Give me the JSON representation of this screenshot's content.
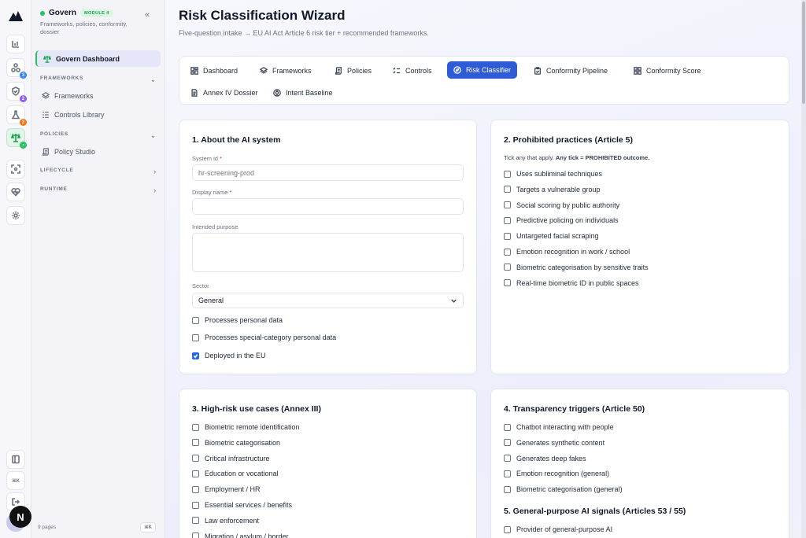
{
  "app": {
    "module_name": "Govern",
    "module_chip": "MODULE 4",
    "module_description": "Frameworks, policies, conformity, dossier"
  },
  "rail": {
    "badges": [
      "3",
      "2",
      "2"
    ],
    "badge_colors": [
      "#3b82f6",
      "#8b5cf6",
      "#f97316",
      "#22c55e"
    ],
    "kbd": "⌘K",
    "avatar_letter": "N"
  },
  "sidebar": {
    "dashboard": "Govern Dashboard",
    "sections": {
      "frameworks": "FRAMEWORKS",
      "policies": "POLICIES",
      "lifecycle": "LIFECYCLE",
      "runtime": "RUNTIME"
    },
    "frameworks_items": [
      "Frameworks",
      "Controls Library"
    ],
    "policies_items": [
      "Policy Studio"
    ],
    "footer_pages": "9 pages",
    "footer_kbd": "⌘K"
  },
  "header": {
    "title": "Risk Classification Wizard",
    "subtitle": "Five-question intake → EU AI Act Article 6 risk tier + recommended frameworks."
  },
  "tabs": [
    {
      "label": "Dashboard",
      "icon": "dashboard-icon"
    },
    {
      "label": "Frameworks",
      "icon": "layers-icon"
    },
    {
      "label": "Policies",
      "icon": "scroll-icon"
    },
    {
      "label": "Controls",
      "icon": "list-checks-icon"
    },
    {
      "label": "Risk Classifier",
      "icon": "compass-icon",
      "active": true
    },
    {
      "label": "Conformity Pipeline",
      "icon": "clipboard-icon"
    },
    {
      "label": "Conformity Score",
      "icon": "grid-icon"
    },
    {
      "label": "Annex IV Dossier",
      "icon": "document-icon"
    },
    {
      "label": "Intent Baseline",
      "icon": "target-icon"
    }
  ],
  "about": {
    "title": "1. About the AI system",
    "system_id_label": "System id",
    "system_id_placeholder": "hr-screening-prod",
    "display_name_label": "Display name",
    "display_name_value": "",
    "purpose_label": "Intended purpose",
    "purpose_value": "",
    "sector_label": "Sector",
    "sector_value": "General",
    "checks": [
      {
        "label": "Processes personal data",
        "checked": false
      },
      {
        "label": "Processes special-category personal data",
        "checked": false
      },
      {
        "label": "Deployed in the EU",
        "checked": true
      }
    ]
  },
  "prohibited": {
    "title": "2. Prohibited practices (Article 5)",
    "hint_prefix": "Tick any that apply.",
    "hint_bold": "Any tick = PROHIBITED outcome.",
    "items": [
      "Uses subliminal techniques",
      "Targets a vulnerable group",
      "Social scoring by public authority",
      "Predictive policing on individuals",
      "Untargeted facial scraping",
      "Emotion recognition in work / school",
      "Biometric categorisation by sensitive traits",
      "Real-time biometric ID in public spaces"
    ]
  },
  "highrisk": {
    "title": "3. High-risk use cases (Annex III)",
    "items": [
      "Biometric remote identification",
      "Biometric categorisation",
      "Critical infrastructure",
      "Education or vocational",
      "Employment / HR",
      "Essential services / benefits",
      "Law enforcement",
      "Migration / asylum / border"
    ]
  },
  "transparency": {
    "title": "4. Transparency triggers (Article 50)",
    "items": [
      "Chatbot interacting with people",
      "Generates synthetic content",
      "Generates deep fakes",
      "Emotion recognition (general)",
      "Biometric categorisation (general)"
    ]
  },
  "gpai": {
    "title": "5. General-purpose AI signals (Articles 53 / 55)",
    "items": [
      "Provider of general-purpose AI"
    ]
  }
}
